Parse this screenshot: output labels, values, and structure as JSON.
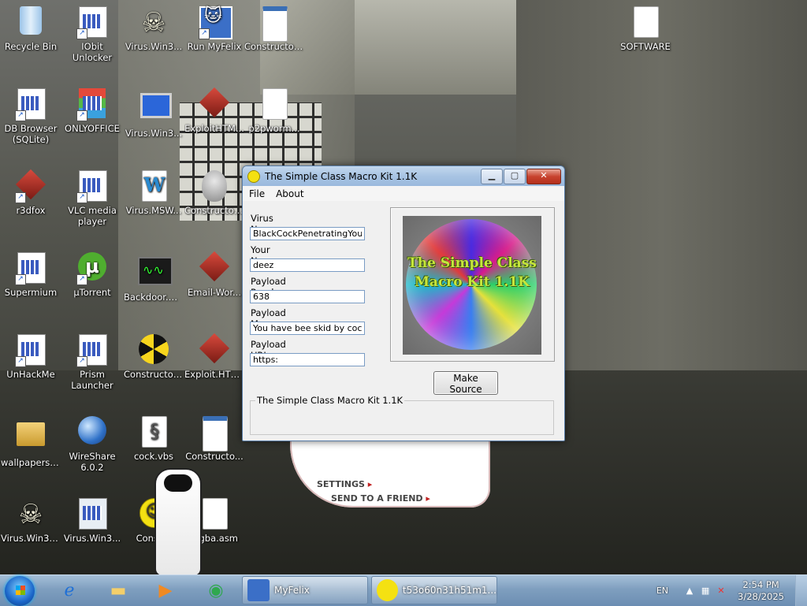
{
  "desktop": {
    "icons": [
      {
        "label": "Recycle Bin"
      },
      {
        "label": "IObit Unlocker"
      },
      {
        "label": "Virus.Win3..."
      },
      {
        "label": "Run MyFelix"
      },
      {
        "label": "Constructor..."
      },
      {
        "label": "SOFTWARE"
      },
      {
        "label": "DB Browser (SQLite)"
      },
      {
        "label": "ONLYOFFICE"
      },
      {
        "label": "Virus.Win3..."
      },
      {
        "label": "ExploitHTM..."
      },
      {
        "label": "p2pworm..."
      },
      {
        "label": "r3dfox"
      },
      {
        "label": "VLC media player"
      },
      {
        "label": "Virus.MSW..."
      },
      {
        "label": "Constructor..."
      },
      {
        "label": "Supermium"
      },
      {
        "label": "µTorrent"
      },
      {
        "label": "Backdoor.W..."
      },
      {
        "label": "Email-Wor..."
      },
      {
        "label": "UnHackMe"
      },
      {
        "label": "Prism Launcher"
      },
      {
        "label": "Constructor..."
      },
      {
        "label": "Exploit.HTM..."
      },
      {
        "label": "wallpapers-..."
      },
      {
        "label": "WireShare 6.0.2"
      },
      {
        "label": "cock.vbs"
      },
      {
        "label": "Constructo..."
      },
      {
        "label": "Virus.Win32..."
      },
      {
        "label": "Virus.Win3..."
      },
      {
        "label": "Constru"
      },
      {
        "label": "ingba.asm"
      }
    ],
    "felix_links": {
      "settings": "SETTINGS",
      "send": "SEND TO A FRIEND",
      "arrow": "▸"
    }
  },
  "dialog": {
    "title": "The Simple Class Macro Kit 1.1K",
    "window_buttons": {
      "minimize": "▁",
      "maximize": "▢",
      "close": "✕"
    },
    "menu": [
      "File",
      "About"
    ],
    "fields": [
      {
        "label": "Virus Name:",
        "value": "BlackCockPenetratingYou"
      },
      {
        "label": "Your Name:",
        "value": "deez"
      },
      {
        "label": "Payload Random:",
        "value": "638"
      },
      {
        "label": "Payload Message:",
        "value": "You have bee skid by cock tam"
      },
      {
        "label": "Payload URL:",
        "value": "https:"
      }
    ],
    "logo_text": "The Simple Class Macro Kit 1.1K",
    "make_button": "Make Source",
    "group_title": "The Simple Class Macro Kit 1.1K"
  },
  "taskbar": {
    "tasks": [
      {
        "label": "MyFelix"
      },
      {
        "label": "t53o60n31h51m1..."
      }
    ],
    "language": "EN",
    "time": "2:54 PM",
    "date": "3/28/2025"
  }
}
